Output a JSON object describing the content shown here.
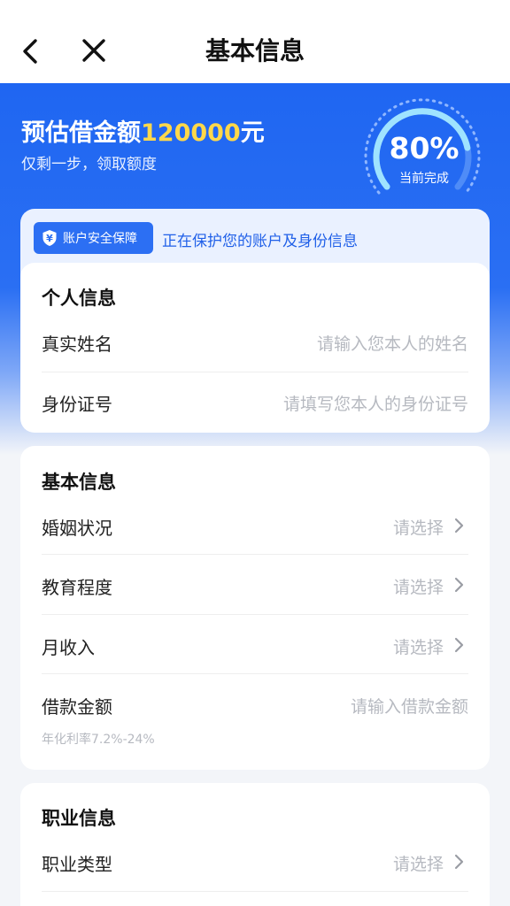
{
  "nav": {
    "title": "基本信息"
  },
  "hero": {
    "title_prefix": "预估借金额",
    "amount": "120000",
    "unit": "元",
    "subtitle": "仅剩一步，领取额度",
    "progress_value": "80%",
    "progress_fraction": 0.8,
    "progress_label": "当前完成"
  },
  "security": {
    "badge_label": "账户安全保障",
    "text": "正在保护您的账户及身份信息"
  },
  "personal": {
    "title": "个人信息",
    "rows": [
      {
        "label": "真实姓名",
        "placeholder": "请输入您本人的姓名"
      },
      {
        "label": "身份证号",
        "placeholder": "请填写您本人的身份证号"
      }
    ]
  },
  "basic": {
    "title": "基本信息",
    "rows": [
      {
        "label": "婚姻状况",
        "value": "请选择"
      },
      {
        "label": "教育程度",
        "value": "请选择"
      },
      {
        "label": "月收入",
        "value": "请选择"
      },
      {
        "label": "借款金额",
        "placeholder": "请输入借款金额"
      }
    ],
    "rate_hint": "年化利率7.2%-24%"
  },
  "job": {
    "title": "职业信息",
    "rows": [
      {
        "label": "职业类型",
        "value": "请选择"
      }
    ]
  },
  "colors": {
    "primary": "#2c6ff3",
    "highlight": "#ffd84a",
    "placeholder": "#b6b9c0"
  }
}
